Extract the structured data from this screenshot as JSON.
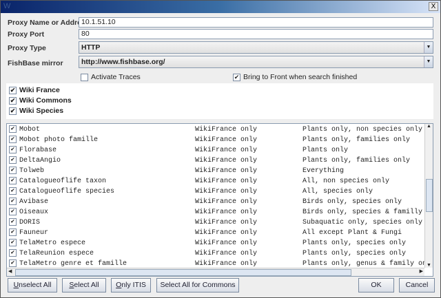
{
  "window": {
    "title": "W",
    "close_label": "X"
  },
  "form": {
    "proxy_name": {
      "label": "Proxy Name or Address",
      "value": "10.1.51.10"
    },
    "proxy_port": {
      "label": "Proxy Port",
      "value": "80"
    },
    "proxy_type": {
      "label": "Proxy Type",
      "value": "HTTP"
    },
    "mirror": {
      "label": "FishBase mirror",
      "value": "http://www.fishbase.org/"
    },
    "activate_traces": {
      "label": "Activate Traces",
      "checked": false
    },
    "bring_to_front": {
      "label": "Bring to Front when search finished",
      "checked": true
    }
  },
  "wikis": [
    {
      "label": "Wiki France",
      "checked": true
    },
    {
      "label": "Wiki Commons",
      "checked": true
    },
    {
      "label": "Wiki Species",
      "checked": true
    }
  ],
  "sources": [
    {
      "name": "Mobot",
      "wiki": "WikiFrance only",
      "scope": "Plants only, non species only"
    },
    {
      "name": "Mobot photo famille",
      "wiki": "WikiFrance only",
      "scope": "Plants only, families only"
    },
    {
      "name": "Florabase",
      "wiki": "WikiFrance only",
      "scope": "Plants only"
    },
    {
      "name": "DeltaAngio",
      "wiki": "WikiFrance only",
      "scope": "Plants only, families only"
    },
    {
      "name": "Tolweb",
      "wiki": "WikiFrance only",
      "scope": "Everything"
    },
    {
      "name": "Catalogueoflife taxon",
      "wiki": "WikiFrance only",
      "scope": "All, non species only"
    },
    {
      "name": "Catalogueoflife species",
      "wiki": "WikiFrance only",
      "scope": "All, species only"
    },
    {
      "name": "Avibase",
      "wiki": "WikiFrance only",
      "scope": "Birds only, species only"
    },
    {
      "name": "Oiseaux",
      "wiki": "WikiFrance only",
      "scope": "Birds only, species & familly & ordo"
    },
    {
      "name": "DORIS",
      "wiki": "WikiFrance only",
      "scope": "Subaquatic only, species only"
    },
    {
      "name": "Fauneur",
      "wiki": "WikiFrance only",
      "scope": "All except Plant & Fungi"
    },
    {
      "name": "TelaMetro espece",
      "wiki": "WikiFrance only",
      "scope": "Plants only, species only"
    },
    {
      "name": "TelaReunion espece",
      "wiki": "WikiFrance only",
      "scope": "Plants only, species only"
    },
    {
      "name": "TelaMetro genre et famille",
      "wiki": "WikiFrance only",
      "scope": "Plants only, genus & family only"
    }
  ],
  "buttons": {
    "unselect_all": "Unselect All",
    "select_all": "Select All",
    "only_itis": "Only ITIS",
    "select_commons": "Select All for Commons",
    "ok": "OK",
    "cancel": "Cancel"
  },
  "check_glyph": "✔"
}
